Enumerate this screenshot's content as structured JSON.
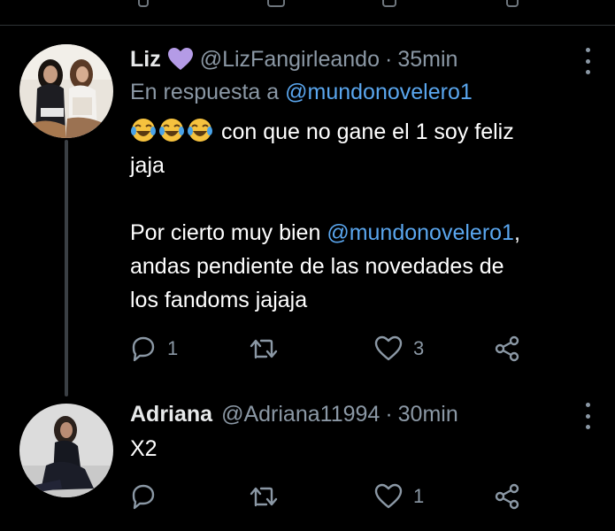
{
  "tweets": [
    {
      "name": "Liz",
      "handle": "@LizFangirleando",
      "time": "35min",
      "reply_prefix": "En respuesta a",
      "reply_mention": "@mundonovelero1",
      "text": {
        "line1_emoji_count": 3,
        "line1_after_emoji": " con que no gane el 1 soy feliz",
        "line2": "jaja",
        "line3_before": "Por cierto muy bien ",
        "line3_mention": "@mundonovelero1",
        "line3_after": ",",
        "line4": "andas pendiente de las novedades de",
        "line5": "los fandoms jajaja"
      },
      "counts": {
        "replies": "1",
        "retweets": "",
        "likes": "3"
      }
    },
    {
      "name": "Adriana",
      "handle": "@Adriana11994",
      "time": "30min",
      "text": {
        "line1": "X2"
      },
      "counts": {
        "replies": "",
        "retweets": "",
        "likes": "1"
      }
    }
  ],
  "separator": "·",
  "colors": {
    "background": "#000000",
    "text": "#e7e9ea",
    "muted": "#8b98a5",
    "link": "#5aa6ee",
    "badge": "#b49be6"
  },
  "icons": [
    "purple-heart-icon",
    "more-options-icon",
    "reply-icon",
    "retweet-icon",
    "like-icon",
    "share-icon",
    "laughing-crying-emoji-icon"
  ]
}
